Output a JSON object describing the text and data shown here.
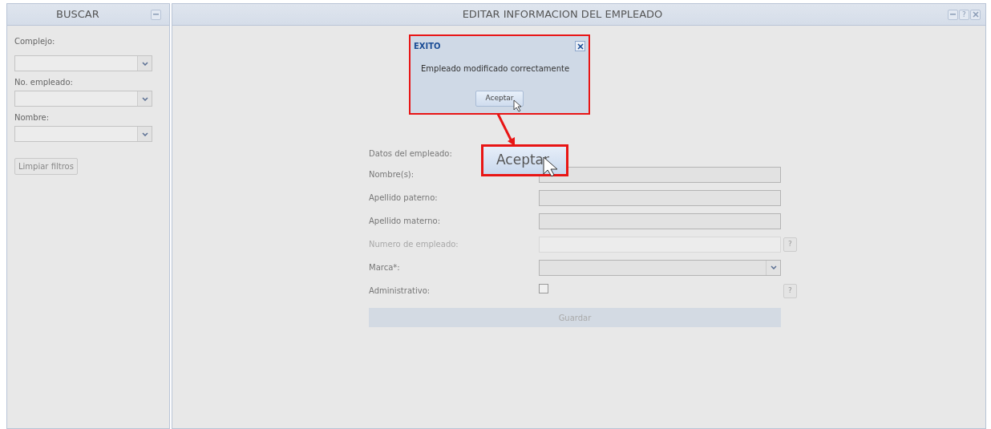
{
  "sidebar": {
    "title": "BUSCAR",
    "filters": [
      {
        "label": "Complejo:"
      },
      {
        "label": "No. empleado:"
      },
      {
        "label": "Nombre:"
      }
    ],
    "clear_button": "Limpiar filtros"
  },
  "main": {
    "title": "EDITAR INFORMACION DEL EMPLEADO",
    "help_button": "?",
    "section_label": "Datos del empleado:",
    "fields": [
      {
        "label": "Nombre(s):",
        "kind": "text"
      },
      {
        "label": "Apellido paterno:",
        "kind": "text"
      },
      {
        "label": "Apellido materno:",
        "kind": "text"
      },
      {
        "label": "Numero de empleado:",
        "kind": "text",
        "disabled": true,
        "help": "?"
      },
      {
        "label": "Marca*:",
        "kind": "select"
      },
      {
        "label": "Administrativo:",
        "kind": "checkbox",
        "checked": false,
        "help": "?"
      }
    ],
    "save_button": {
      "label": "Guardar",
      "disabled": true
    }
  },
  "dialog": {
    "title": "EXITO",
    "message": "Empleado modificado correctamente",
    "button": "Aceptar"
  },
  "callout": {
    "button": "Aceptar"
  }
}
